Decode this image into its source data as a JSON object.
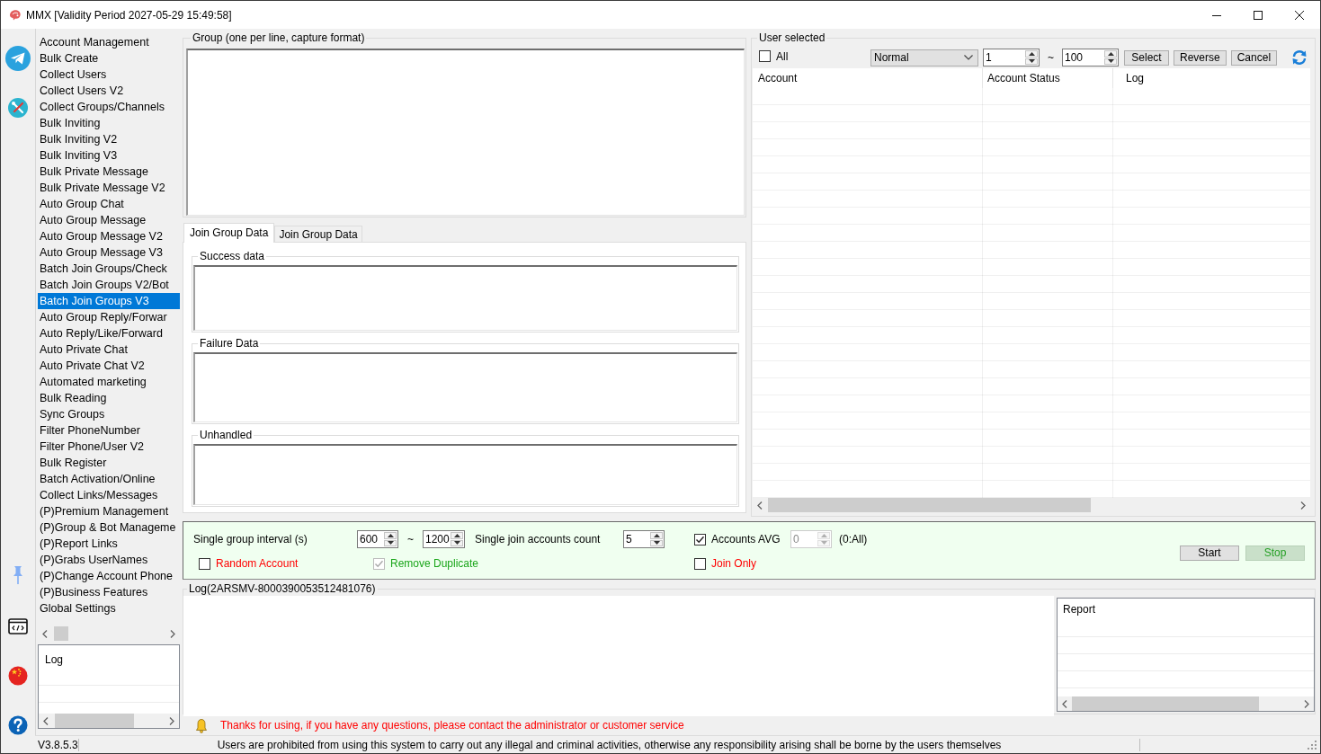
{
  "window": {
    "title": "MMX [Validity Period 2027-05-29 15:49:58]"
  },
  "menu": {
    "items": [
      {
        "label": "Account Management",
        "selected": false
      },
      {
        "label": "Bulk Create",
        "selected": false
      },
      {
        "label": "Collect Users",
        "selected": false
      },
      {
        "label": "Collect Users V2",
        "selected": false
      },
      {
        "label": "Collect Groups/Channels",
        "selected": false
      },
      {
        "label": "Bulk Inviting",
        "selected": false
      },
      {
        "label": "Bulk Inviting V2",
        "selected": false
      },
      {
        "label": "Bulk Inviting V3",
        "selected": false
      },
      {
        "label": "Bulk Private Message",
        "selected": false
      },
      {
        "label": "Bulk Private Message V2",
        "selected": false
      },
      {
        "label": "Auto Group Chat",
        "selected": false
      },
      {
        "label": "Auto Group Message",
        "selected": false
      },
      {
        "label": "Auto Group Message V2",
        "selected": false
      },
      {
        "label": "Auto Group Message V3",
        "selected": false
      },
      {
        "label": "Batch Join Groups/Check",
        "selected": false
      },
      {
        "label": "Batch Join Groups V2/Bot",
        "selected": false
      },
      {
        "label": "Batch Join Groups V3",
        "selected": true
      },
      {
        "label": "Auto Group Reply/Forwar",
        "selected": false
      },
      {
        "label": "Auto Reply/Like/Forward",
        "selected": false
      },
      {
        "label": "Auto Private Chat",
        "selected": false
      },
      {
        "label": "Auto Private Chat V2",
        "selected": false
      },
      {
        "label": "Automated marketing",
        "selected": false
      },
      {
        "label": "Bulk Reading",
        "selected": false
      },
      {
        "label": "Sync Groups",
        "selected": false
      },
      {
        "label": "Filter PhoneNumber",
        "selected": false
      },
      {
        "label": "Filter Phone/User V2",
        "selected": false
      },
      {
        "label": "Bulk Register",
        "selected": false
      },
      {
        "label": "Batch Activation/Online",
        "selected": false
      },
      {
        "label": "Collect Links/Messages",
        "selected": false
      },
      {
        "label": "(P)Premium Management",
        "selected": false
      },
      {
        "label": "(P)Group & Bot Manageme",
        "selected": false
      },
      {
        "label": "(P)Report Links",
        "selected": false
      },
      {
        "label": "(P)Grabs UserNames",
        "selected": false
      },
      {
        "label": "(P)Change Account Phone",
        "selected": false
      },
      {
        "label": "(P)Business Features",
        "selected": false
      },
      {
        "label": "Global Settings",
        "selected": false
      }
    ]
  },
  "menu_log": {
    "columns": [
      "Log"
    ]
  },
  "group_input": {
    "label": "Group (one per line, capture format)"
  },
  "result_tabs": [
    {
      "label": "Join Group Data",
      "selected": true
    },
    {
      "label": "Join Group Data",
      "selected": false
    }
  ],
  "result_boxes": [
    {
      "label": "Success data"
    },
    {
      "label": "Failure Data"
    },
    {
      "label": "Unhandled"
    }
  ],
  "user_selected": {
    "title": "User selected",
    "all": {
      "label": "All",
      "checked": false
    },
    "filter": "Normal",
    "range_from": "1",
    "range_separator": "~",
    "range_to": "100",
    "buttons": [
      "Select",
      "Reverse",
      "Cancel"
    ],
    "columns": [
      "Account",
      "Account Status",
      "Log"
    ]
  },
  "settings": {
    "interval_label": "Single group interval (s)",
    "interval_from": "600",
    "interval_separator": "~",
    "interval_to": "1200",
    "accounts_count_label": "Single join accounts count",
    "accounts_count": "5",
    "accounts_avg": {
      "label": "Accounts AVG",
      "checked": true
    },
    "avg_value": {
      "value": "0",
      "disabled": true
    },
    "avg_hint": "(0:All)",
    "random_account": {
      "label": "Random Account",
      "checked": false
    },
    "remove_duplicate": {
      "label": "Remove Duplicate",
      "checked": true,
      "disabled": true
    },
    "join_only": {
      "label": "Join Only",
      "checked": false
    },
    "buttons": [
      {
        "label": "Start",
        "disabled": false
      },
      {
        "label": "Stop",
        "disabled": true
      }
    ]
  },
  "log": {
    "title": "Log(2ARSMV-8000390053512481076)",
    "report_columns": [
      "Report"
    ]
  },
  "notice": "Thanks for using, if you have any questions, please contact the administrator or customer service",
  "status_bar": {
    "version": "V3.8.5.3",
    "message": "Users are prohibited from using this system to carry out any illegal and criminal activities, otherwise any responsibility arising shall be borne by the users themselves"
  }
}
